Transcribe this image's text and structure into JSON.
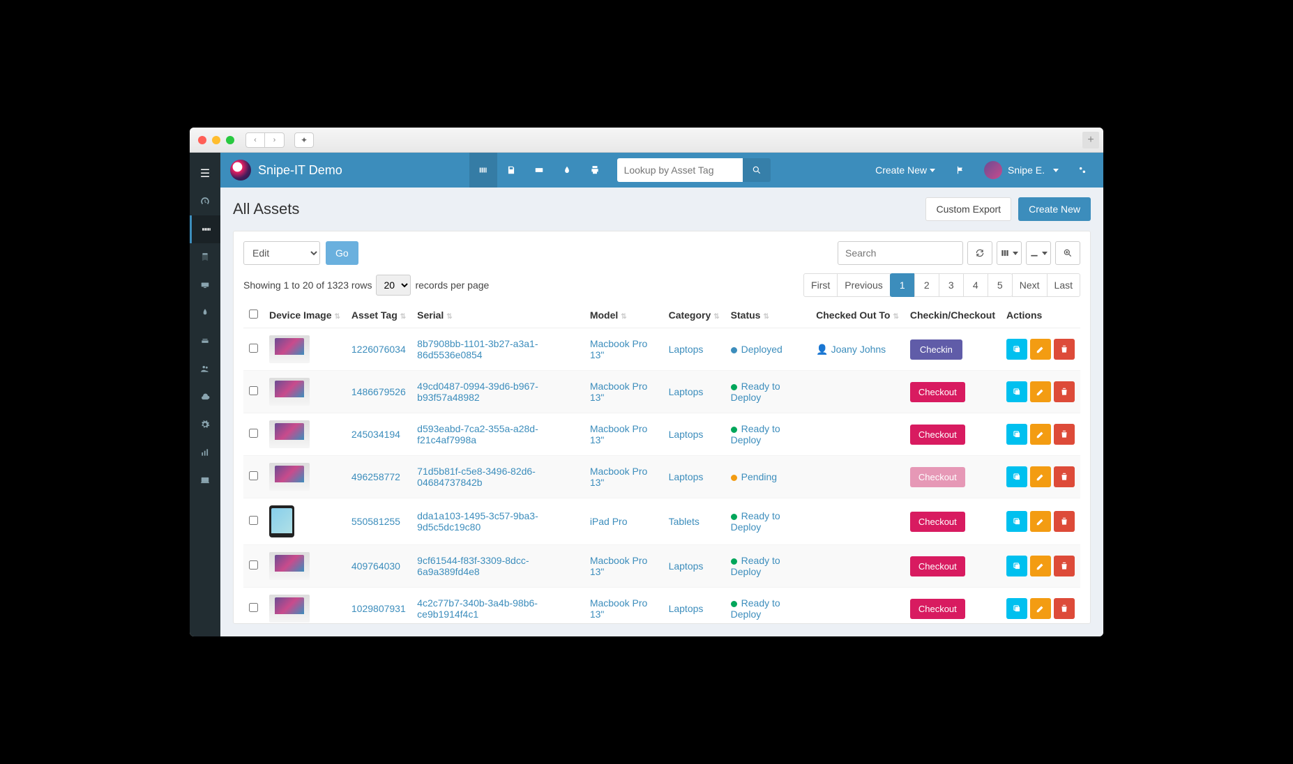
{
  "brand": "Snipe-IT Demo",
  "topbar": {
    "search_placeholder": "Lookup by Asset Tag",
    "create_new": "Create New",
    "user_name": "Snipe E."
  },
  "page": {
    "title": "All Assets",
    "custom_export": "Custom Export",
    "create_new": "Create New"
  },
  "toolbar": {
    "edit_select": "Edit",
    "go": "Go",
    "search_placeholder": "Search"
  },
  "meta": {
    "showing_prefix": "Showing 1 to 20 of 1323 rows",
    "per_page": "20",
    "per_page_suffix": "records per page"
  },
  "pagination": {
    "first": "First",
    "previous": "Previous",
    "pages": [
      "1",
      "2",
      "3",
      "4",
      "5"
    ],
    "active": "1",
    "next": "Next",
    "last": "Last"
  },
  "columns": {
    "device_image": "Device Image",
    "asset_tag": "Asset Tag",
    "serial": "Serial",
    "model": "Model",
    "category": "Category",
    "status": "Status",
    "checked_out_to": "Checked Out To",
    "checkin_checkout": "Checkin/Checkout",
    "actions": "Actions"
  },
  "status_labels": {
    "deployed": "Deployed",
    "ready": "Ready to Deploy",
    "pending": "Pending"
  },
  "buttons": {
    "checkin": "Checkin",
    "checkout": "Checkout"
  },
  "rows": [
    {
      "img": "laptop",
      "tag": "1226076034",
      "serial": "8b7908bb-1101-3b27-a3a1-86d5536e0854",
      "model": "Macbook Pro 13\"",
      "category": "Laptops",
      "status": "deployed",
      "status_dot": "blue",
      "checked_out": "Joany Johns",
      "action": "checkin"
    },
    {
      "img": "laptop",
      "tag": "1486679526",
      "serial": "49cd0487-0994-39d6-b967-b93f57a48982",
      "model": "Macbook Pro 13\"",
      "category": "Laptops",
      "status": "ready",
      "status_dot": "green",
      "checked_out": "",
      "action": "checkout"
    },
    {
      "img": "laptop",
      "tag": "245034194",
      "serial": "d593eabd-7ca2-355a-a28d-f21c4af7998a",
      "model": "Macbook Pro 13\"",
      "category": "Laptops",
      "status": "ready",
      "status_dot": "green",
      "checked_out": "",
      "action": "checkout"
    },
    {
      "img": "laptop",
      "tag": "496258772",
      "serial": "71d5b81f-c5e8-3496-82d6-04684737842b",
      "model": "Macbook Pro 13\"",
      "category": "Laptops",
      "status": "pending",
      "status_dot": "orange",
      "checked_out": "",
      "action": "checkout_disabled"
    },
    {
      "img": "tablet",
      "tag": "550581255",
      "serial": "dda1a103-1495-3c57-9ba3-9d5c5dc19c80",
      "model": "iPad Pro",
      "category": "Tablets",
      "status": "ready",
      "status_dot": "green",
      "checked_out": "",
      "action": "checkout"
    },
    {
      "img": "laptop",
      "tag": "409764030",
      "serial": "9cf61544-f83f-3309-8dcc-6a9a389fd4e8",
      "model": "Macbook Pro 13\"",
      "category": "Laptops",
      "status": "ready",
      "status_dot": "green",
      "checked_out": "",
      "action": "checkout"
    },
    {
      "img": "laptop",
      "tag": "1029807931",
      "serial": "4c2c77b7-340b-3a4b-98b6-ce9b1914f4c1",
      "model": "Macbook Pro 13\"",
      "category": "Laptops",
      "status": "ready",
      "status_dot": "green",
      "checked_out": "",
      "action": "checkout"
    }
  ]
}
